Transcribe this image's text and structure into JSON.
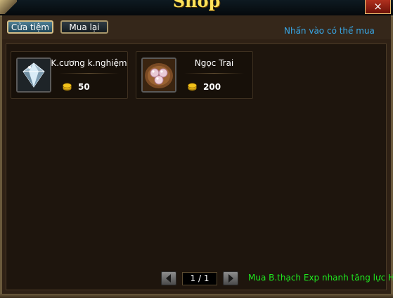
{
  "window": {
    "title": "Shop",
    "close_glyph": "×"
  },
  "tabs": [
    {
      "label": "Cửa tiệm",
      "active": true
    },
    {
      "label": "Mua lại",
      "active": false
    }
  ],
  "hint": "Nhấn vào có thể mua",
  "items": [
    {
      "name": "K.cương k.nghiệm",
      "price": "50",
      "icon": "diamond-icon"
    },
    {
      "name": "Ngọc Trai",
      "price": "200",
      "icon": "pearl-icon"
    }
  ],
  "pager": {
    "label": "1 / 1"
  },
  "footer": {
    "message": "Mua B.thạch Exp nhanh tăng lực HĐ"
  },
  "colors": {
    "title": "#ffe25a",
    "hint": "#38a7e6",
    "footer": "#1fe81f",
    "coin": "#f2c21a"
  }
}
